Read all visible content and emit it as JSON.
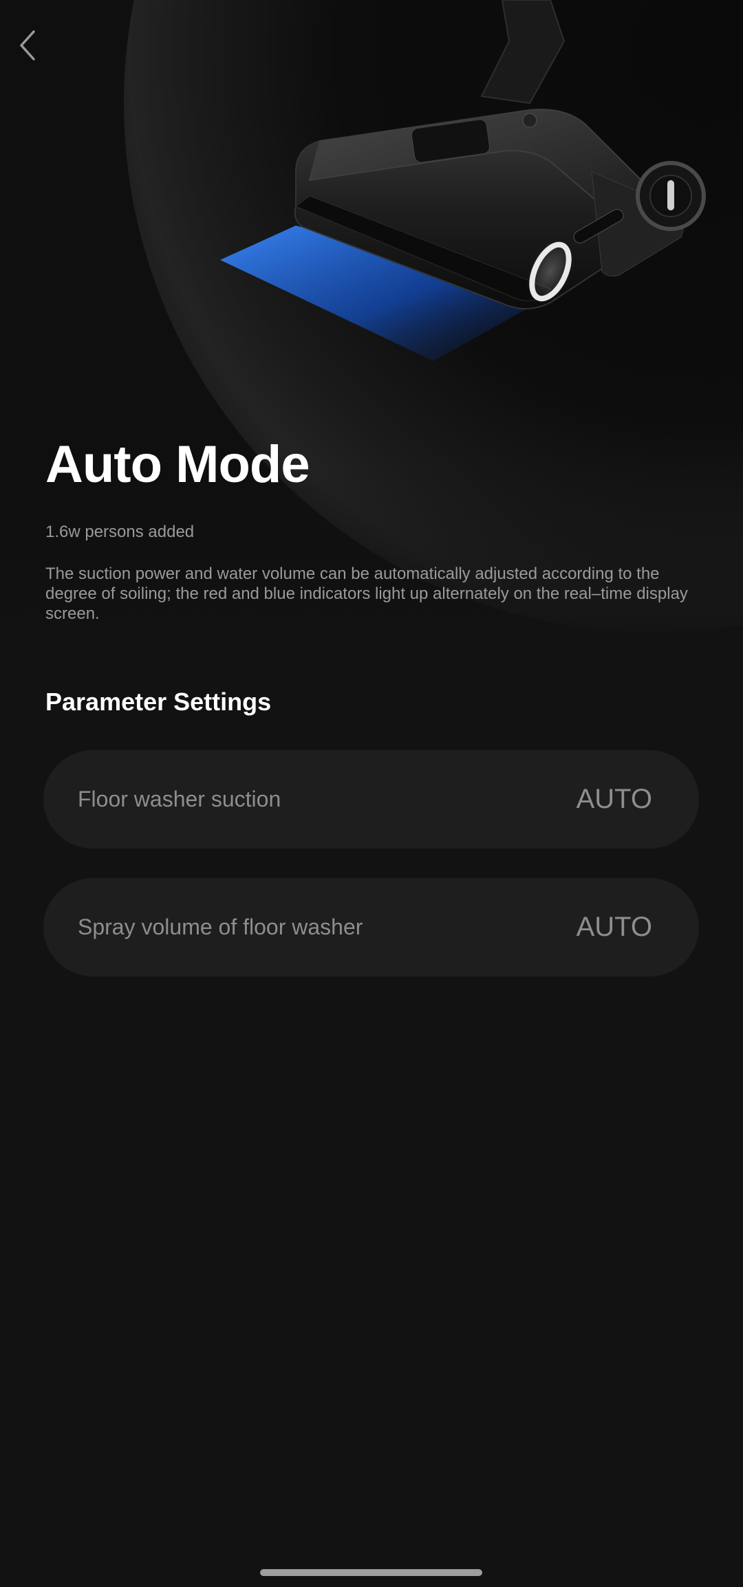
{
  "header": {
    "back_icon": "chevron-left-icon"
  },
  "hero": {
    "image": "floor-washer-product-image",
    "accent_color": "#1e6fff"
  },
  "mode": {
    "title": "Auto Mode",
    "added_count": "1.6w persons added",
    "description": "The suction power and water volume can be automatically adjusted according to the degree of soiling; the red and blue indicators light up alternately on the real–time display screen."
  },
  "parameters": {
    "section_title": "Parameter Settings",
    "items": [
      {
        "label": "Floor washer suction",
        "value": "AUTO"
      },
      {
        "label": "Spray volume of floor washer",
        "value": "AUTO"
      }
    ]
  },
  "colors": {
    "background": "#121212",
    "card": "#1e1e1e",
    "muted_text": "#8e8e8e"
  }
}
